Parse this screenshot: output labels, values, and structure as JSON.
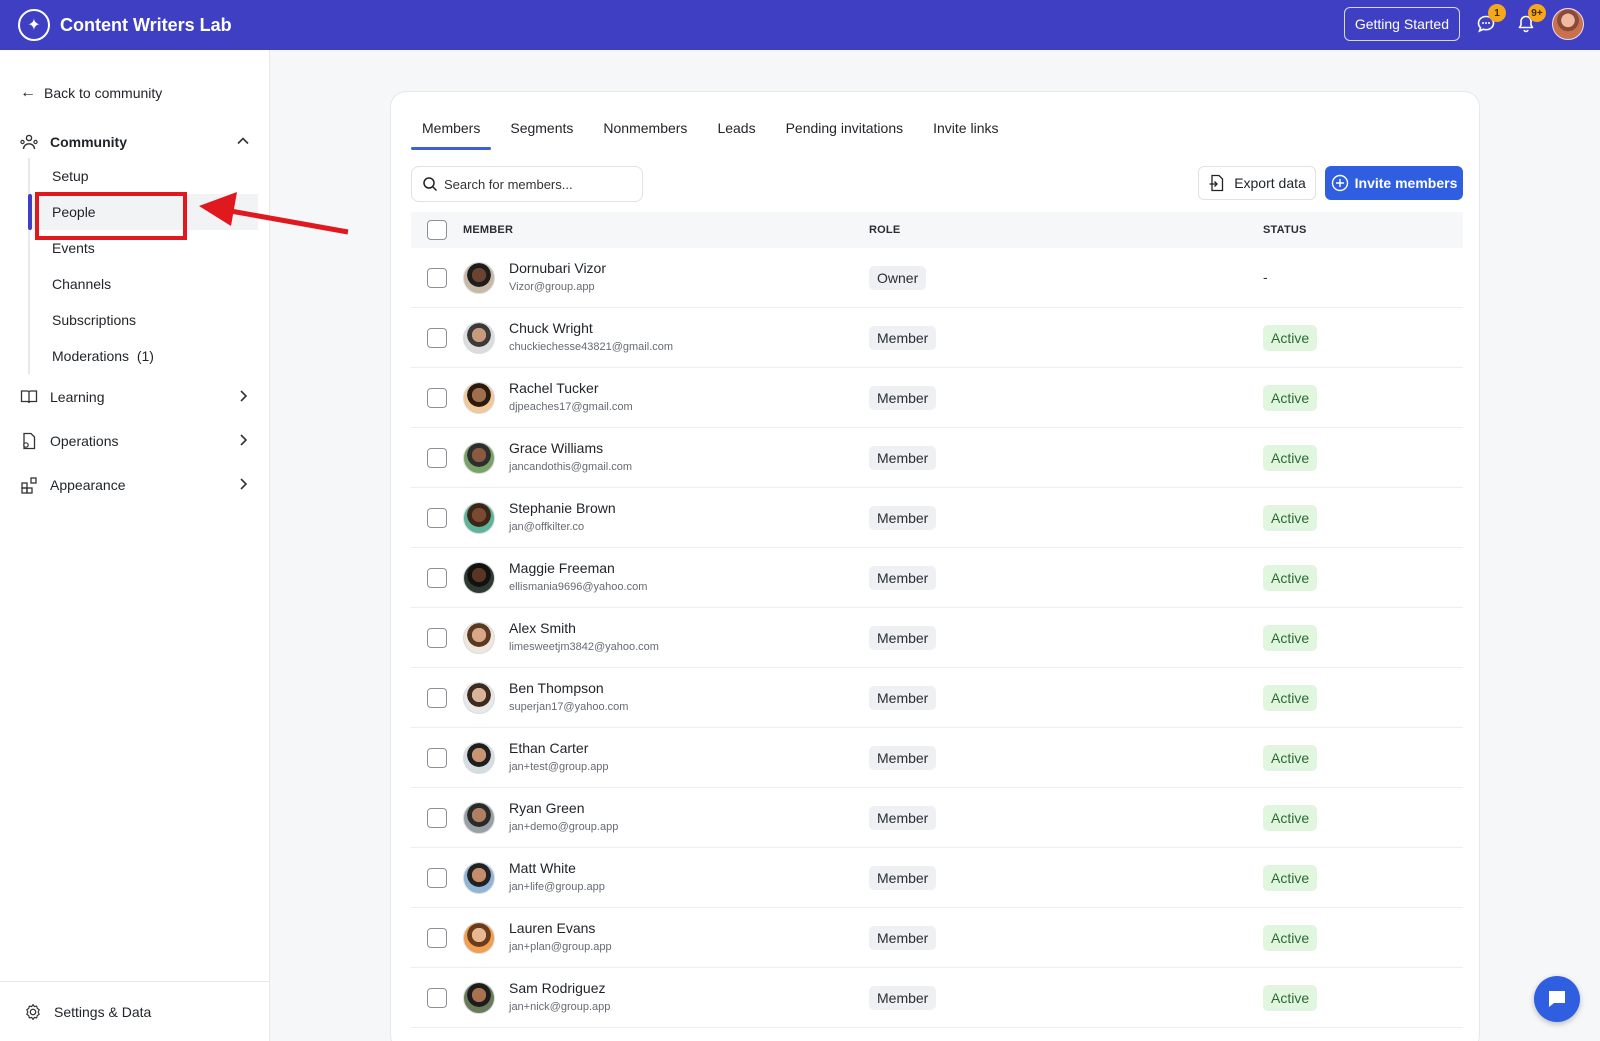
{
  "header": {
    "app_title": "Content Writers Lab",
    "getting_started": "Getting Started",
    "messages_badge": "1",
    "notifications_badge": "9+",
    "brand_color": "#3f3fc4"
  },
  "sidebar": {
    "back_label": "Back to community",
    "community_label": "Community",
    "community_items": [
      {
        "label": "Setup"
      },
      {
        "label": "People"
      },
      {
        "label": "Events"
      },
      {
        "label": "Channels"
      },
      {
        "label": "Subscriptions"
      },
      {
        "label": "Moderations  (1)"
      }
    ],
    "active_item": "People",
    "learning_label": "Learning",
    "operations_label": "Operations",
    "appearance_label": "Appearance",
    "settings_label": "Settings & Data"
  },
  "tabs": [
    {
      "label": "Members"
    },
    {
      "label": "Segments"
    },
    {
      "label": "Nonmembers"
    },
    {
      "label": "Leads"
    },
    {
      "label": "Pending invitations"
    },
    {
      "label": "Invite links"
    }
  ],
  "toolbar": {
    "search_placeholder": "Search for members...",
    "export_label": "Export data",
    "invite_label": "Invite members"
  },
  "table": {
    "headers": {
      "member": "MEMBER",
      "role": "ROLE",
      "status": "STATUS"
    },
    "rows": [
      {
        "name": "Dornubari Vizor",
        "email": "Vizor@group.app",
        "role": "Owner",
        "status": "-"
      },
      {
        "name": "Chuck Wright",
        "email": "chuckiechesse43821@gmail.com",
        "role": "Member",
        "status": "Active"
      },
      {
        "name": "Rachel Tucker",
        "email": "djpeaches17@gmail.com",
        "role": "Member",
        "status": "Active"
      },
      {
        "name": "Grace Williams",
        "email": "jancandothis@gmail.com",
        "role": "Member",
        "status": "Active"
      },
      {
        "name": "Stephanie Brown",
        "email": "jan@offkilter.co",
        "role": "Member",
        "status": "Active"
      },
      {
        "name": "Maggie Freeman",
        "email": "ellismania9696@yahoo.com",
        "role": "Member",
        "status": "Active"
      },
      {
        "name": "Alex Smith",
        "email": "limesweetjm3842@yahoo.com",
        "role": "Member",
        "status": "Active"
      },
      {
        "name": "Ben Thompson",
        "email": "superjan17@yahoo.com",
        "role": "Member",
        "status": "Active"
      },
      {
        "name": "Ethan Carter",
        "email": "jan+test@group.app",
        "role": "Member",
        "status": "Active"
      },
      {
        "name": "Ryan Green",
        "email": "jan+demo@group.app",
        "role": "Member",
        "status": "Active"
      },
      {
        "name": "Matt White",
        "email": "jan+life@group.app",
        "role": "Member",
        "status": "Active"
      },
      {
        "name": "Lauren Evans",
        "email": "jan+plan@group.app",
        "role": "Member",
        "status": "Active"
      },
      {
        "name": "Sam Rodriguez",
        "email": "jan+nick@group.app",
        "role": "Member",
        "status": "Active"
      }
    ]
  }
}
